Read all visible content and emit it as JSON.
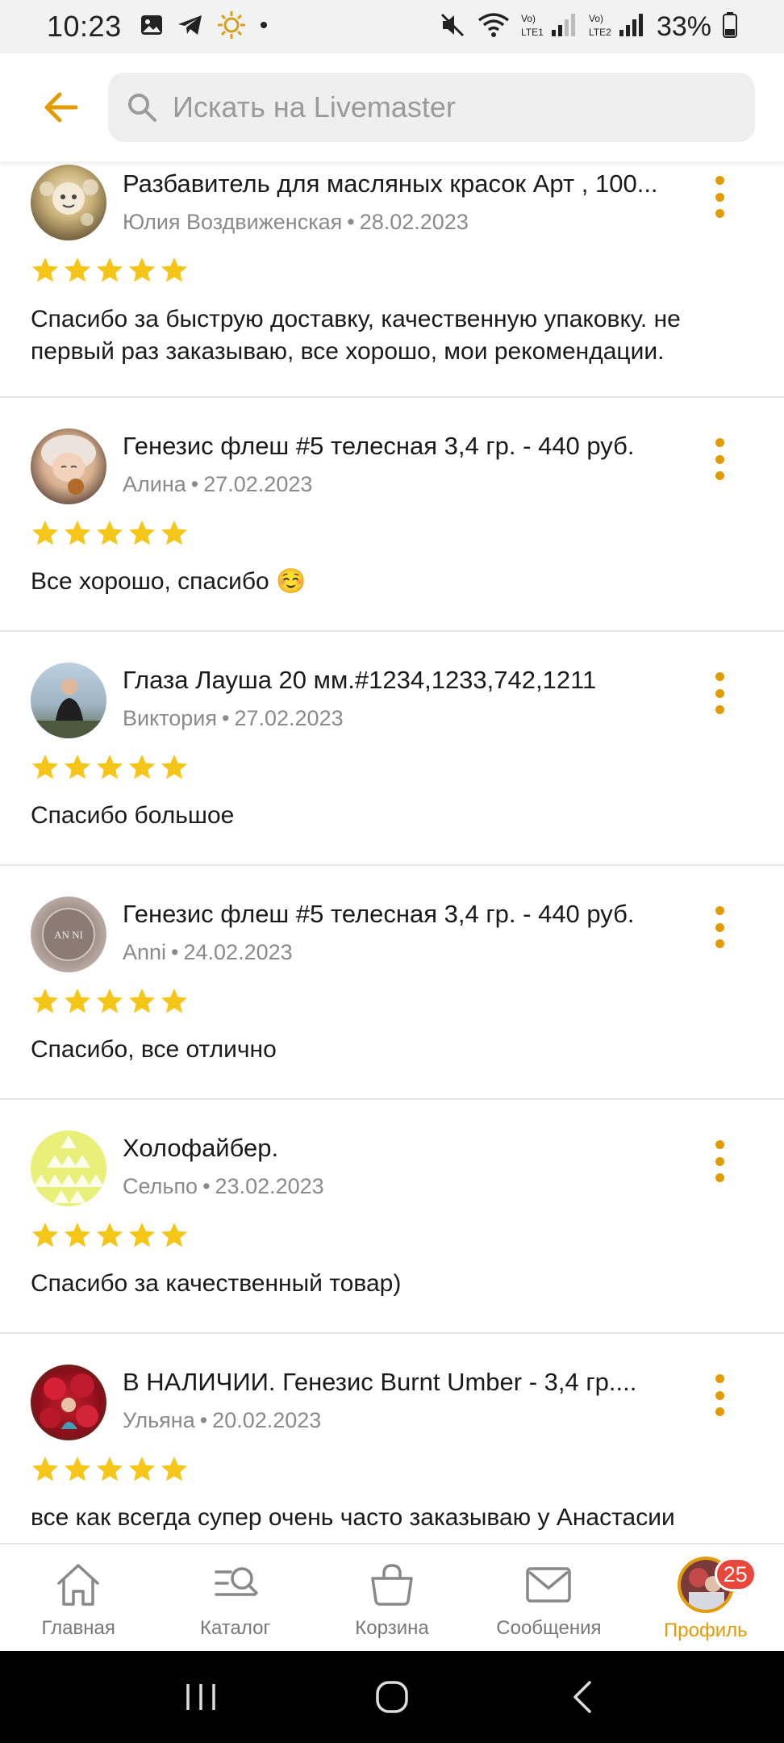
{
  "status_bar": {
    "time": "10:23",
    "battery": "33%",
    "left_icons": [
      "gallery-icon",
      "telegram-icon",
      "sun-icon",
      "dot-icon"
    ],
    "right_icons": [
      "mute-icon",
      "wifi-icon",
      "lte1-signal-icon",
      "lte2-signal-icon",
      "battery-icon"
    ],
    "lte1_label": "Vo) LTE1",
    "lte2_label": "Vo) LTE2"
  },
  "header": {
    "back_icon": "arrow-left-icon",
    "search_placeholder": "Искать на Livemaster"
  },
  "accent_color": "#e39b00",
  "star_color": "#f5c518",
  "reviews": [
    {
      "title": "Разбавитель для масляных красок Арт , 100...",
      "author": "Юлия Воздвиженская",
      "date": "28.02.2023",
      "rating": 5,
      "text": "Спасибо за быструю доставку, качественную упаковку. не первый раз заказываю, все хорошо, мои рекомендации."
    },
    {
      "title": "Генезис флеш #5 телесная  3,4 гр. - 440 руб.",
      "author": "Алина",
      "date": "27.02.2023",
      "rating": 5,
      "text": "Все хорошо, спасибо ☺️"
    },
    {
      "title": "Глаза Лауша 20 мм.#1234,1233,742,1211",
      "author": "Виктория",
      "date": "27.02.2023",
      "rating": 5,
      "text": "Спасибо большое"
    },
    {
      "title": "Генезис флеш #5 телесная  3,4 гр. - 440 руб.",
      "author": "Anni",
      "date": "24.02.2023",
      "rating": 5,
      "text": "Спасибо, все отлично",
      "avatar_text": "AN NI"
    },
    {
      "title": "Холофайбер.",
      "author": "Сельпо",
      "date": "23.02.2023",
      "rating": 5,
      "text": "Спасибо за качественный товар)"
    },
    {
      "title": "В НАЛИЧИИ. Генезис Burnt Umber - 3,4 гр....",
      "author": "Ульяна",
      "date": "20.02.2023",
      "rating": 5,
      "text": "все как всегда супер очень часто заказываю у Анастасии"
    }
  ],
  "bottom_nav": {
    "items": [
      {
        "label": "Главная",
        "icon": "home-icon"
      },
      {
        "label": "Каталог",
        "icon": "catalog-search-icon"
      },
      {
        "label": "Корзина",
        "icon": "basket-icon"
      },
      {
        "label": "Сообщения",
        "icon": "envelope-icon"
      },
      {
        "label": "Профиль",
        "icon": "profile-avatar",
        "active": true
      }
    ],
    "profile_badge": "25"
  },
  "system_nav": {
    "buttons": [
      "recent-apps-icon",
      "home-circle-icon",
      "back-chevron-icon"
    ]
  }
}
